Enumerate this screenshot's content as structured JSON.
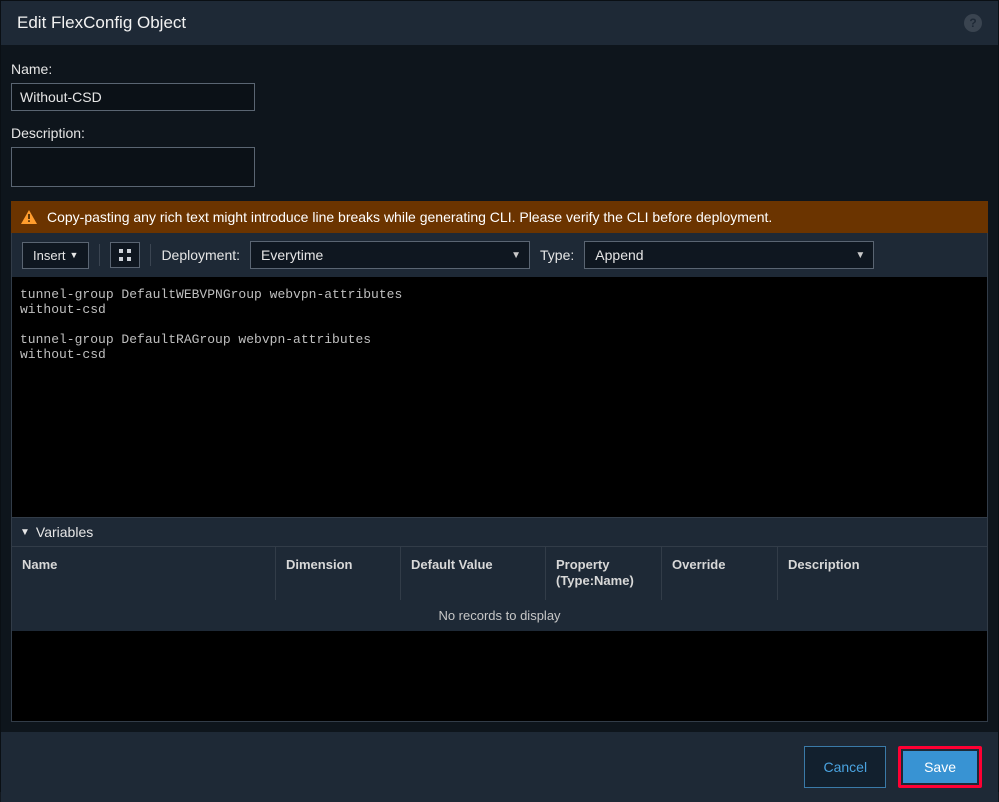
{
  "dialog": {
    "title": "Edit FlexConfig Object"
  },
  "fields": {
    "name_label": "Name:",
    "name_value": "Without-CSD",
    "description_label": "Description:",
    "description_value": ""
  },
  "warning": {
    "text": "Copy-pasting any rich text might introduce line breaks while generating CLI. Please verify the CLI before deployment."
  },
  "toolbar": {
    "insert_label": "Insert",
    "deployment_label": "Deployment:",
    "deployment_value": "Everytime",
    "type_label": "Type:",
    "type_value": "Append"
  },
  "code": "tunnel-group DefaultWEBVPNGroup webvpn-attributes\nwithout-csd\n\ntunnel-group DefaultRAGroup webvpn-attributes\nwithout-csd",
  "variables": {
    "section_title": "Variables",
    "columns": {
      "name": "Name",
      "dimension": "Dimension",
      "default": "Default Value",
      "property": "Property\n(Type:Name)",
      "override": "Override",
      "description": "Description"
    },
    "empty_message": "No records to display"
  },
  "footer": {
    "cancel": "Cancel",
    "save": "Save"
  }
}
